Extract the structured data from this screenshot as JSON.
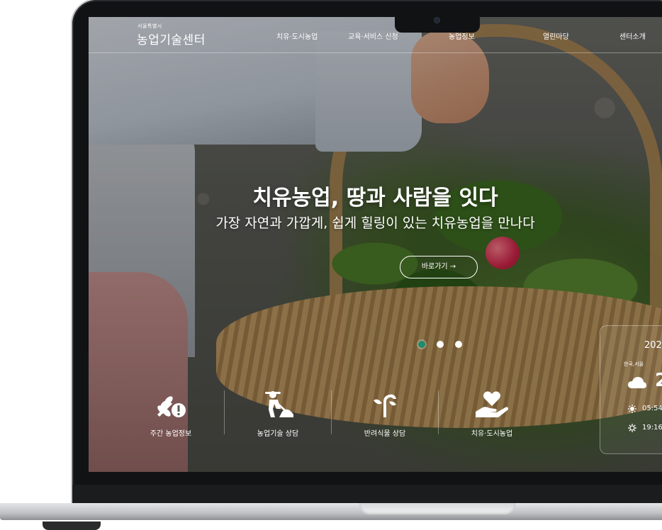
{
  "header": {
    "logo_small": "서울특별시",
    "logo_main": "농업기술센터",
    "nav": [
      "치유·도시농업",
      "교육·서비스 신청",
      "농업정보",
      "열린마당",
      "센터소개"
    ]
  },
  "hero": {
    "title": "치유농업, 땅과 사람을 잇다",
    "subtitle": "가장 자연과 가깝게, 쉽게 힐링이 있는 치유농업을 만나다",
    "cta_label": "바로가기 →",
    "slides_total": 3,
    "active_slide": 1
  },
  "quick_links": [
    {
      "label": "주간 농업정보",
      "icon": "wheat-alert-icon"
    },
    {
      "label": "농업기술 상담",
      "icon": "farmer-digging-icon"
    },
    {
      "label": "반려식물 상담",
      "icon": "plant-sprout-icon"
    },
    {
      "label": "치유·도시농업",
      "icon": "heart-hand-icon"
    }
  ],
  "weather": {
    "year_fragment": "202",
    "location": "한국,서울",
    "temp_fragment": "2",
    "sunrise_fragment": "05:54",
    "sunset_fragment": "19:16"
  },
  "colors": {
    "accent_green": "#1f8c6a",
    "text": "#ffffff"
  }
}
